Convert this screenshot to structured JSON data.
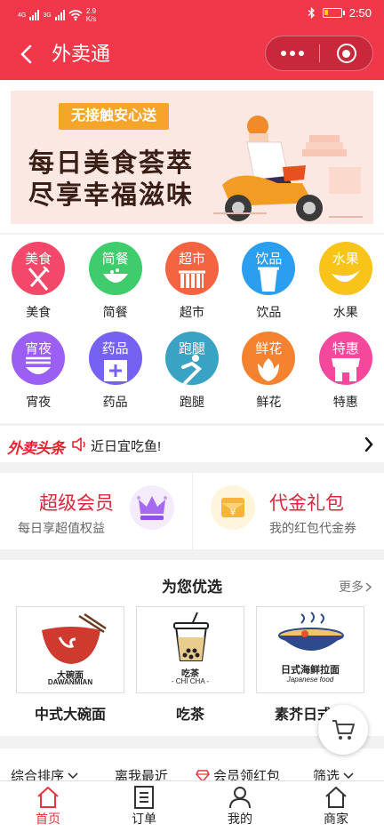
{
  "status_bar": {
    "network_type": "4G",
    "network_type_2": "3G",
    "speed_value": "2.9",
    "speed_unit": "K/s",
    "time": "2:50"
  },
  "header": {
    "title": "外卖通"
  },
  "banner": {
    "tag": "无接触安心送",
    "line1": "每日美食荟萃",
    "line2": "尽享幸福滋味"
  },
  "categories": [
    {
      "icon_text": "美食",
      "label": "美食",
      "color": "#f4486a",
      "icon": "fork-knife-icon"
    },
    {
      "icon_text": "简餐",
      "label": "简餐",
      "color": "#3fcc6c",
      "icon": "bowl-icon"
    },
    {
      "icon_text": "超市",
      "label": "超市",
      "color": "#f56440",
      "icon": "basket-icon"
    },
    {
      "icon_text": "饮品",
      "label": "饮品",
      "color": "#2c9ef0",
      "icon": "cup-icon"
    },
    {
      "icon_text": "水果",
      "label": "水果",
      "color": "#f8c41a",
      "icon": "banana-icon"
    },
    {
      "icon_text": "宵夜",
      "label": "宵夜",
      "color": "#9b5ff4",
      "icon": "noodle-icon"
    },
    {
      "icon_text": "药品",
      "label": "药品",
      "color": "#7561f2",
      "icon": "medicine-box-icon"
    },
    {
      "icon_text": "跑腿",
      "label": "跑腿",
      "color": "#3aa2c2",
      "icon": "runner-icon"
    },
    {
      "icon_text": "鲜花",
      "label": "鲜花",
      "color": "#f5822f",
      "icon": "flower-icon"
    },
    {
      "icon_text": "特惠",
      "label": "特惠",
      "color": "#f4489c",
      "icon": "shop-awning-icon"
    }
  ],
  "headline": {
    "logo": "外卖头条",
    "text": "近日宜吃鱼!"
  },
  "member": {
    "left": {
      "title": "超级会员",
      "subtitle": "每日享超值权益"
    },
    "right": {
      "title": "代金礼包",
      "subtitle": "我的红包代金券"
    }
  },
  "recommend": {
    "title": "为您优选",
    "more": "更多",
    "items": [
      {
        "name": "中式大碗面",
        "card_text": "大碗面",
        "card_subtext": "DAWANMIAN"
      },
      {
        "name": "吃茶",
        "card_text": "吃茶",
        "card_subtext": "- CHI CHA -"
      },
      {
        "name": "素芥日式拉",
        "card_text": "日式海鲜拉面",
        "card_subtext": "Japanese food"
      }
    ]
  },
  "filter": {
    "sort": "综合排序",
    "distance": "离我最近",
    "member": "会员领红包",
    "screen": "筛选"
  },
  "tabbar": [
    {
      "label": "首页",
      "active": true
    },
    {
      "label": "订单",
      "active": false
    },
    {
      "label": "我的",
      "active": false
    },
    {
      "label": "商家",
      "active": false
    }
  ],
  "colors": {
    "brand": "#f0384a",
    "active_tab": "#e8323f",
    "member_title": "#d9263a"
  }
}
